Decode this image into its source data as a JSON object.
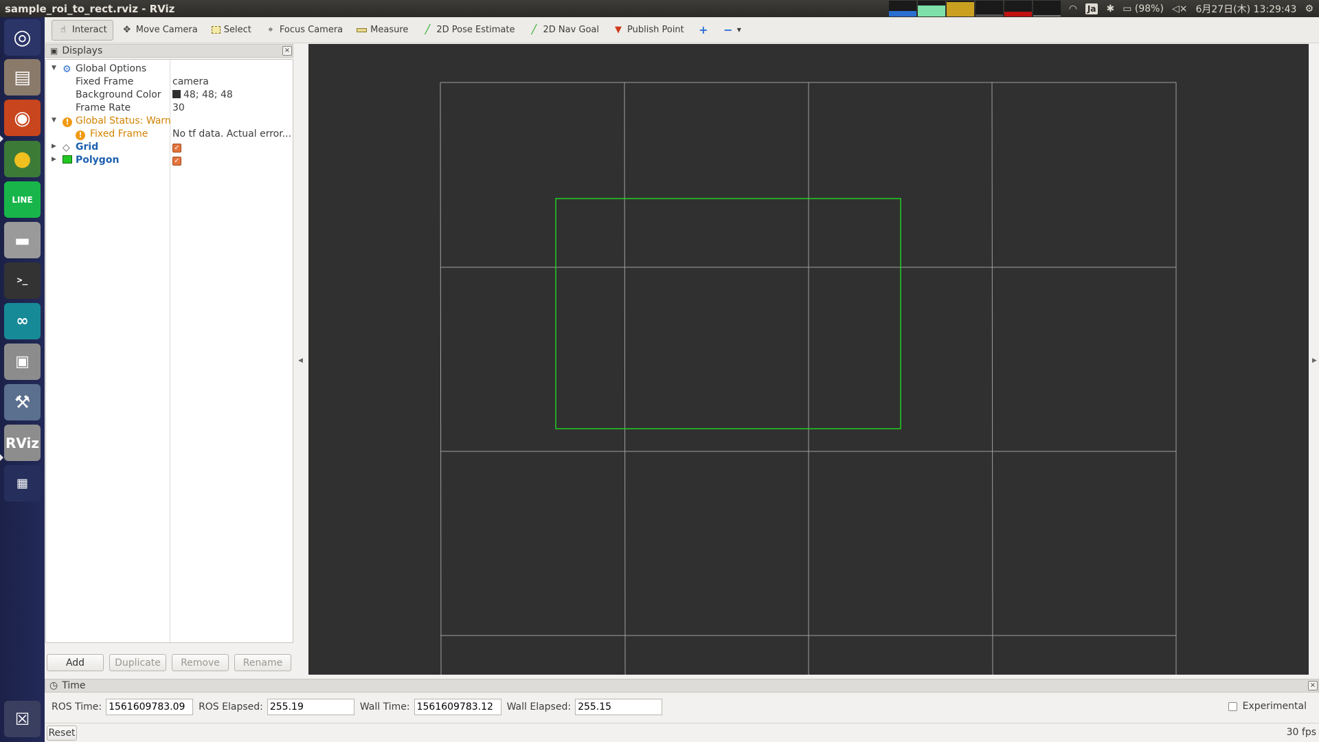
{
  "window": {
    "title": "sample_roi_to_rect.rviz - RViz"
  },
  "system": {
    "keyboard": "Ja",
    "battery": "(98%)",
    "datetime": "6月27日(木) 13:29:43"
  },
  "toolbar": {
    "interact": "Interact",
    "move_camera": "Move Camera",
    "select": "Select",
    "focus_camera": "Focus Camera",
    "measure": "Measure",
    "pose_estimate": "2D Pose Estimate",
    "nav_goal": "2D Nav Goal",
    "publish_point": "Publish Point"
  },
  "displays": {
    "title": "Displays",
    "global_options": "Global Options",
    "fixed_frame_label": "Fixed Frame",
    "fixed_frame_value": "camera",
    "bg_color_label": "Background Color",
    "bg_color_value": "48; 48; 48",
    "bg_color_hex": "#303030",
    "frame_rate_label": "Frame Rate",
    "frame_rate_value": "30",
    "global_status": "Global Status: Warn",
    "status_fixed_frame": "Fixed Frame",
    "status_fixed_frame_msg": "No tf data.  Actual error...",
    "grid": "Grid",
    "polygon": "Polygon",
    "buttons": {
      "add": "Add",
      "duplicate": "Duplicate",
      "remove": "Remove",
      "rename": "Rename"
    }
  },
  "time": {
    "title": "Time",
    "ros_time_label": "ROS Time:",
    "ros_time": "1561609783.09",
    "ros_elapsed_label": "ROS Elapsed:",
    "ros_elapsed": "255.19",
    "wall_time_label": "Wall Time:",
    "wall_time": "1561609783.12",
    "wall_elapsed_label": "Wall Elapsed:",
    "wall_elapsed": "255.15",
    "experimental": "Experimental"
  },
  "status": {
    "reset": "Reset",
    "fps": "30 fps"
  },
  "colors": {
    "polygon": "#22cc22",
    "grid": "#a0a0a0",
    "warn": "#d28300"
  }
}
